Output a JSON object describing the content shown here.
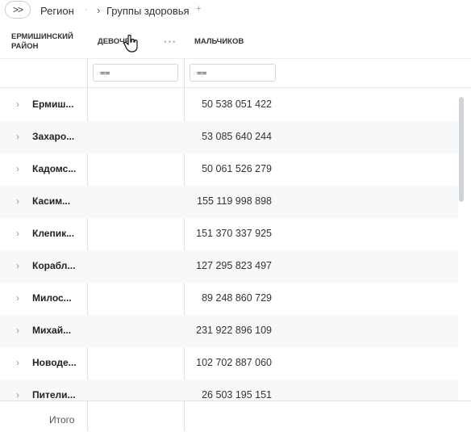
{
  "toolbar": {
    "expand_label": ">>",
    "crumb_1": "Регион",
    "crumb_sep": "›",
    "crumb_2": "Группы здоровья",
    "crumb_add": "+"
  },
  "header": {
    "col_1": "ЕРМИШИНСКИЙ РАЙОН",
    "col_2": "ДЕВОЧЕ",
    "col_3": "МАЛЬЧИКОВ",
    "dots": "•••"
  },
  "filters": {
    "icon_glyph": "⩵"
  },
  "rows": [
    {
      "name": "Ермиш...",
      "value": "50 538 051 422"
    },
    {
      "name": "Захаро...",
      "value": "53 085 640 244"
    },
    {
      "name": "Кадомс...",
      "value": "50 061 526 279"
    },
    {
      "name": "Касим...",
      "value": "155 119 998 898"
    },
    {
      "name": "Клепик...",
      "value": "151 370 337 925"
    },
    {
      "name": "Корабл...",
      "value": "127 295 823 497"
    },
    {
      "name": "Милос...",
      "value": "89 248 860 729"
    },
    {
      "name": "Михай...",
      "value": "231 922 896 109"
    },
    {
      "name": "Новоде...",
      "value": "102 702 887 060"
    },
    {
      "name": "Пители...",
      "value": "26 503 195 151"
    }
  ],
  "row_chevron": "›",
  "footer": {
    "total_label": "Итого"
  }
}
